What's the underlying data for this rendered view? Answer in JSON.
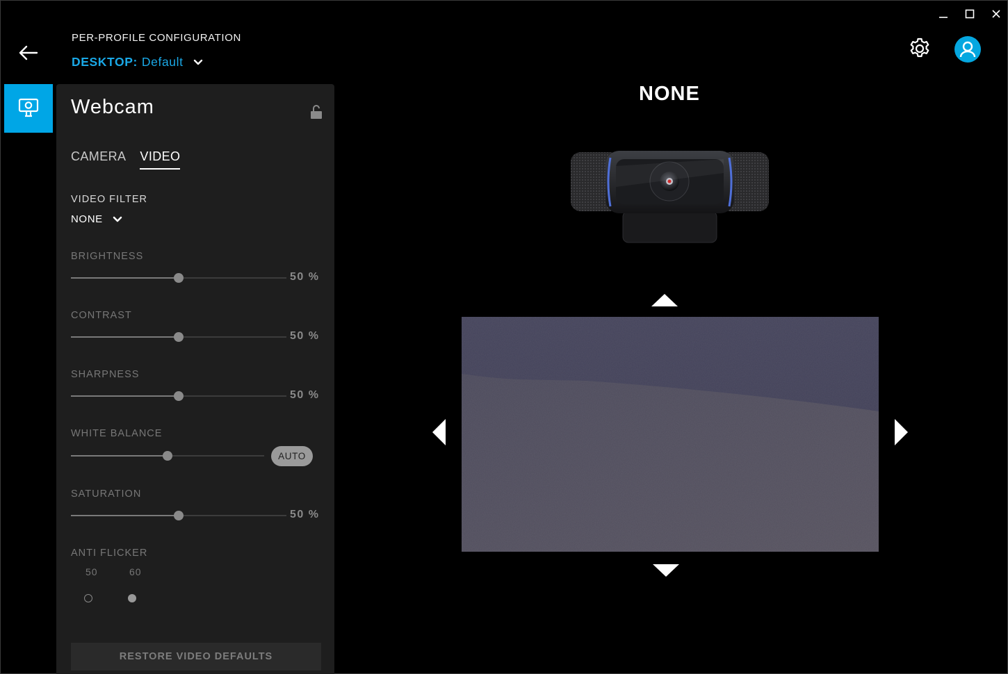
{
  "header": {
    "title": "PER-PROFILE CONFIGURATION",
    "profile_key": "DESKTOP:",
    "profile_value": "Default"
  },
  "panel": {
    "title": "Webcam",
    "tabs": [
      {
        "label": "CAMERA",
        "active": false
      },
      {
        "label": "VIDEO",
        "active": true
      }
    ],
    "video_filter": {
      "label": "VIDEO FILTER",
      "value": "NONE"
    },
    "brightness": {
      "label": "BRIGHTNESS",
      "value": "50 %",
      "level": 0.5
    },
    "contrast": {
      "label": "CONTRAST",
      "value": "50 %",
      "level": 0.5
    },
    "sharpness": {
      "label": "SHARPNESS",
      "value": "50 %",
      "level": 0.5
    },
    "white_balance": {
      "label": "WHITE BALANCE",
      "auto_label": "AUTO",
      "level": 0.5
    },
    "saturation": {
      "label": "SATURATION",
      "value": "50 %",
      "level": 0.5
    },
    "anti_flicker": {
      "label": "ANTI FLICKER",
      "options": [
        {
          "label": "50",
          "selected": false
        },
        {
          "label": "60",
          "selected": true
        }
      ]
    },
    "restore_label": "RESTORE VIDEO DEFAULTS"
  },
  "preview": {
    "title": "NONE"
  },
  "colors": {
    "accent": "#00a6e6",
    "background": "#000000",
    "panel": "#1e1e1e"
  },
  "icons": [
    "back-arrow-icon",
    "chevron-down-icon",
    "gear-icon",
    "user-icon",
    "webcam-icon",
    "unlock-icon",
    "triangle-up-icon",
    "triangle-down-icon",
    "triangle-left-icon",
    "triangle-right-icon",
    "minimize-icon",
    "maximize-icon",
    "close-icon"
  ]
}
